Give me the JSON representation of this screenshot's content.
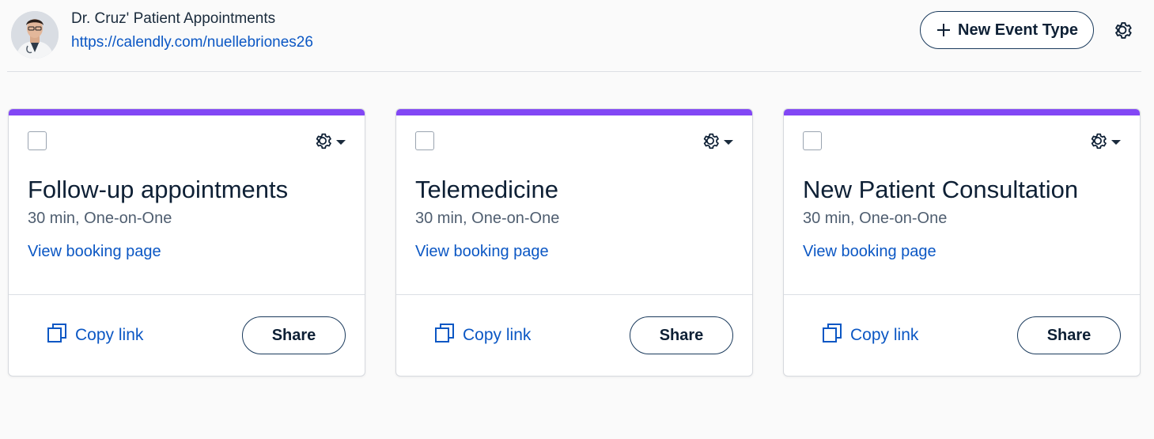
{
  "header": {
    "owner_name": "Dr. Cruz' Patient Appointments",
    "booking_url": "https://calendly.com/nuellebriones26",
    "new_event_label": "New Event Type",
    "settings_icon": "gear-icon"
  },
  "colors": {
    "accent_bar": "#8247f5",
    "link": "#0b57c4",
    "text_dark": "#0e2035",
    "text_muted": "#4f5e70"
  },
  "cards": [
    {
      "title": "Follow-up appointments",
      "meta": "30 min, One-on-One",
      "view_label": "View booking page",
      "copy_label": "Copy link",
      "share_label": "Share"
    },
    {
      "title": "Telemedicine",
      "meta": "30 min, One-on-One",
      "view_label": "View booking page",
      "copy_label": "Copy link",
      "share_label": "Share"
    },
    {
      "title": "New Patient Consultation",
      "meta": "30 min, One-on-One",
      "view_label": "View booking page",
      "copy_label": "Copy link",
      "share_label": "Share"
    }
  ]
}
